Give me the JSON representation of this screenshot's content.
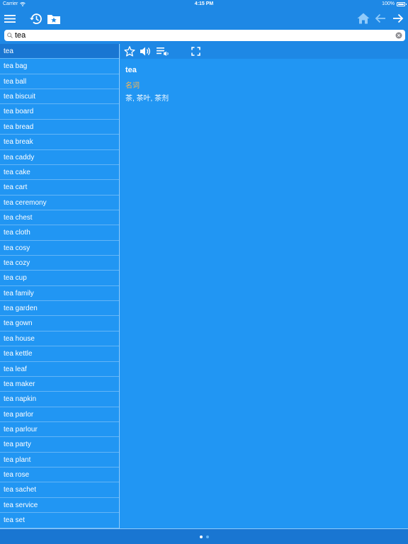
{
  "status": {
    "carrier": "Carrier",
    "time": "4:15 PM",
    "battery": "100%",
    "battery_level": 1.0
  },
  "navbar": {
    "menu_icon": "hamburger-menu-icon",
    "history_icon": "history-clock-icon",
    "favorites_icon": "favorites-folder-star-icon",
    "home_icon": "home-icon",
    "back_icon": "arrow-left-icon",
    "forward_icon": "arrow-right-icon"
  },
  "search": {
    "value": "tea",
    "placeholder": "",
    "icon": "search-icon",
    "clear_icon": "clear-circle-icon"
  },
  "list": {
    "selected_index": 0,
    "items": [
      "tea",
      "tea bag",
      "tea ball",
      "tea biscuit",
      "tea board",
      "tea bread",
      "tea break",
      "tea caddy",
      "tea cake",
      "tea cart",
      "tea ceremony",
      "tea chest",
      "tea cloth",
      "tea cosy",
      "tea cozy",
      "tea cup",
      "tea family",
      "tea garden",
      "tea gown",
      "tea house",
      "tea kettle",
      "tea leaf",
      "tea maker",
      "tea napkin",
      "tea parlor",
      "tea parlour",
      "tea party",
      "tea plant",
      "tea rose",
      "tea sachet",
      "tea service",
      "tea set"
    ]
  },
  "toolbar": {
    "star_icon": "star-outline-icon",
    "speaker_icon": "speaker-icon",
    "playlist_icon": "playlist-audio-icon",
    "fullscreen_icon": "fullscreen-icon"
  },
  "entry": {
    "headword": "tea",
    "pos": "名词",
    "meaning": "茶, 茶叶, 茶剂"
  },
  "footer": {
    "page_count": 2,
    "active_page": 1
  },
  "colors": {
    "background": "#2196F3",
    "bar": "#1E88E5",
    "selected": "#1976D2",
    "pos_orange": "#FFB74D",
    "divider": "#64B5F6"
  }
}
